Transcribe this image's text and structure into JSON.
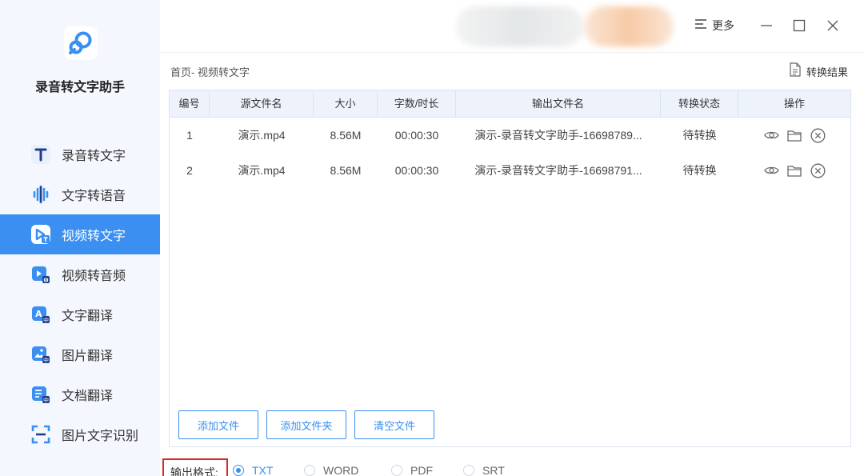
{
  "app": {
    "title": "录音转文字助手"
  },
  "sidebar": {
    "items": [
      {
        "label": "录音转文字",
        "icon": "letter-t-icon",
        "active": false
      },
      {
        "label": "文字转语音",
        "icon": "sound-wave-icon",
        "active": false
      },
      {
        "label": "视频转文字",
        "icon": "video-text-icon",
        "active": true
      },
      {
        "label": "视频转音频",
        "icon": "video-audio-icon",
        "active": false
      },
      {
        "label": "文字翻译",
        "icon": "text-translate-icon",
        "active": false
      },
      {
        "label": "图片翻译",
        "icon": "image-translate-icon",
        "active": false
      },
      {
        "label": "文档翻译",
        "icon": "document-translate-icon",
        "active": false
      },
      {
        "label": "图片文字识别",
        "icon": "ocr-scan-icon",
        "active": false
      }
    ]
  },
  "titlebar": {
    "more_label": "更多"
  },
  "breadcrumb": "首页- 视频转文字",
  "result_link": "转换结果",
  "table": {
    "headers": [
      "编号",
      "源文件名",
      "大小",
      "字数/时长",
      "输出文件名",
      "转换状态",
      "操作"
    ],
    "rows": [
      {
        "no": "1",
        "source": "演示.mp4",
        "size": "8.56M",
        "duration": "00:00:30",
        "output": "演示-录音转文字助手-16698789...",
        "status": "待转换"
      },
      {
        "no": "2",
        "source": "演示.mp4",
        "size": "8.56M",
        "duration": "00:00:30",
        "output": "演示-录音转文字助手-16698791...",
        "status": "待转换"
      }
    ]
  },
  "buttons": {
    "add_file": "添加文件",
    "add_folder": "添加文件夹",
    "clear_files": "清空文件"
  },
  "output_format": {
    "label": "输出格式:",
    "options": [
      "TXT",
      "WORD",
      "PDF",
      "SRT"
    ],
    "selected": "TXT"
  },
  "colors": {
    "accent": "#3a8ff0",
    "sidebar_bg": "#f4f7fd",
    "highlight_box": "#d62a2a"
  }
}
